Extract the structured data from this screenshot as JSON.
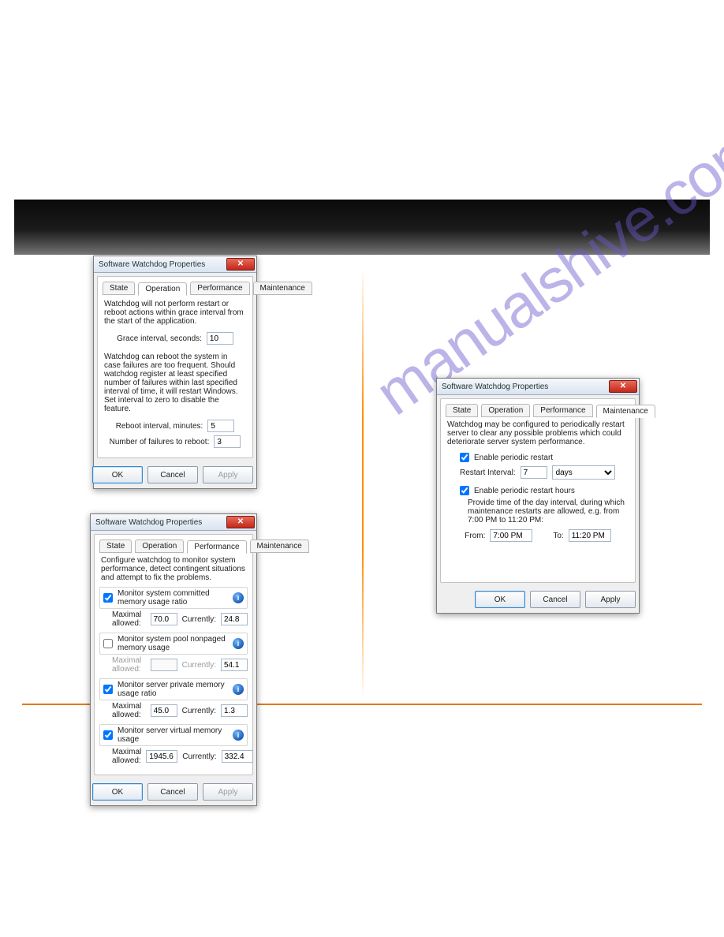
{
  "watermark": "manualshive.com",
  "dialog_op": {
    "title": "Software Watchdog Properties",
    "tabs": {
      "state": "State",
      "operation": "Operation",
      "performance": "Performance",
      "maintenance": "Maintenance"
    },
    "active_tab": "operation",
    "para1": "Watchdog will not perform restart or reboot actions within grace interval from the start of the application.",
    "grace_label": "Grace interval, seconds:",
    "grace_value": "10",
    "para2": "Watchdog can reboot the system in case failures are too frequent. Should watchdog register at least specified number of failures within last specified interval of time, it will restart Windows. Set interval to zero to disable the feature.",
    "reboot_interval_label": "Reboot interval, minutes:",
    "reboot_interval_value": "5",
    "num_failures_label": "Number of failures to reboot:",
    "num_failures_value": "3",
    "buttons": {
      "ok": "OK",
      "cancel": "Cancel",
      "apply": "Apply"
    }
  },
  "dialog_perf": {
    "title": "Software Watchdog Properties",
    "tabs": {
      "state": "State",
      "operation": "Operation",
      "performance": "Performance",
      "maintenance": "Maintenance"
    },
    "active_tab": "performance",
    "intro": "Configure watchdog to monitor system performance, detect contingent situations and attempt to fix the problems.",
    "rows": [
      {
        "check": true,
        "label": "Monitor system committed memory usage ratio",
        "max_label": "Maximal allowed:",
        "max": "70.0",
        "cur_label": "Currently:",
        "cur": "24.8",
        "dim": false
      },
      {
        "check": false,
        "label": "Monitor system pool nonpaged memory usage",
        "max_label": "Maximal allowed:",
        "max": "",
        "cur_label": "Currently:",
        "cur": "54.1",
        "dim": true
      },
      {
        "check": true,
        "label": "Monitor server private memory usage ratio",
        "max_label": "Maximal allowed:",
        "max": "45.0",
        "cur_label": "Currently:",
        "cur": "1.3",
        "dim": false
      },
      {
        "check": true,
        "label": "Monitor server virtual memory usage",
        "max_label": "Maximal allowed:",
        "max": "1945.6",
        "cur_label": "Currently:",
        "cur": "332.4",
        "dim": false
      }
    ],
    "buttons": {
      "ok": "OK",
      "cancel": "Cancel",
      "apply": "Apply"
    }
  },
  "dialog_maint": {
    "title": "Software Watchdog Properties",
    "tabs": {
      "state": "State",
      "operation": "Operation",
      "performance": "Performance",
      "maintenance": "Maintenance"
    },
    "active_tab": "maintenance",
    "intro": "Watchdog may be configured to periodically restart server to clear any possible problems which could deteriorate server system performance.",
    "enable_restart_label": "Enable periodic restart",
    "enable_restart_checked": true,
    "restart_interval_label": "Restart Interval:",
    "restart_interval_value": "7",
    "restart_interval_unit": "days",
    "enable_hours_label": "Enable periodic restart hours",
    "enable_hours_checked": true,
    "hours_intro": "Provide time of the day interval, during which maintenance restarts are allowed, e.g. from 7:00 PM to 11:20 PM:",
    "from_label": "From:",
    "from_value": "7:00 PM",
    "to_label": "To:",
    "to_value": "11:20 PM",
    "buttons": {
      "ok": "OK",
      "cancel": "Cancel",
      "apply": "Apply"
    }
  }
}
